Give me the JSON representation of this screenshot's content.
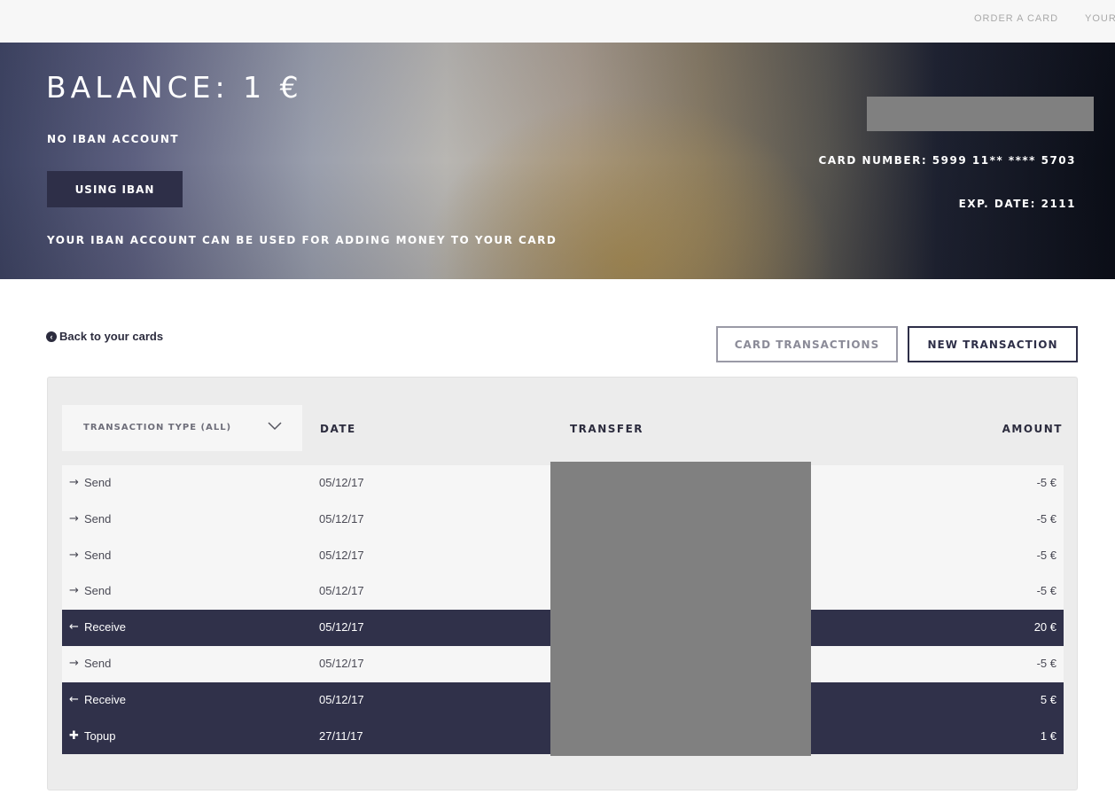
{
  "nav": {
    "order_card": "ORDER A CARD",
    "your": "YOUR"
  },
  "hero": {
    "balance": "BALANCE: 1 €",
    "no_iban": "NO IBAN ACCOUNT",
    "using_iban_button": "USING IBAN",
    "iban_note": "YOUR IBAN ACCOUNT CAN BE USED FOR ADDING MONEY TO YOUR CARD",
    "card_number": "CARD NUMBER: 5999 11** **** 5703",
    "exp_date": "EXP. DATE: 2111"
  },
  "actions": {
    "back_link": "Back to your cards",
    "card_transactions": "CARD TRANSACTIONS",
    "new_transaction": "NEW TRANSACTION"
  },
  "table": {
    "filter_label": "TRANSACTION TYPE (ALL)",
    "headers": {
      "date": "DATE",
      "transfer": "TRANSFER",
      "amount": "AMOUNT"
    },
    "rows": [
      {
        "icon": "→",
        "type": "Send",
        "date": "05/12/17",
        "amount": "-5 €",
        "dark": false
      },
      {
        "icon": "→",
        "type": "Send",
        "date": "05/12/17",
        "amount": "-5 €",
        "dark": false
      },
      {
        "icon": "→",
        "type": "Send",
        "date": "05/12/17",
        "amount": "-5 €",
        "dark": false
      },
      {
        "icon": "→",
        "type": "Send",
        "date": "05/12/17",
        "amount": "-5 €",
        "dark": false
      },
      {
        "icon": "←",
        "type": "Receive",
        "date": "05/12/17",
        "amount": "20 €",
        "dark": true
      },
      {
        "icon": "→",
        "type": "Send",
        "date": "05/12/17",
        "amount": "-5 €",
        "dark": false
      },
      {
        "icon": "←",
        "type": "Receive",
        "date": "05/12/17",
        "amount": "5 €",
        "dark": true
      },
      {
        "icon": "✚",
        "type": "Topup",
        "date": "27/11/17",
        "amount": "1 €",
        "dark": true
      }
    ]
  },
  "colors": {
    "dark_row": "#30314a",
    "light_row": "#f6f6f6",
    "redaction": "#808080",
    "button_dark": "#2e2f48"
  }
}
